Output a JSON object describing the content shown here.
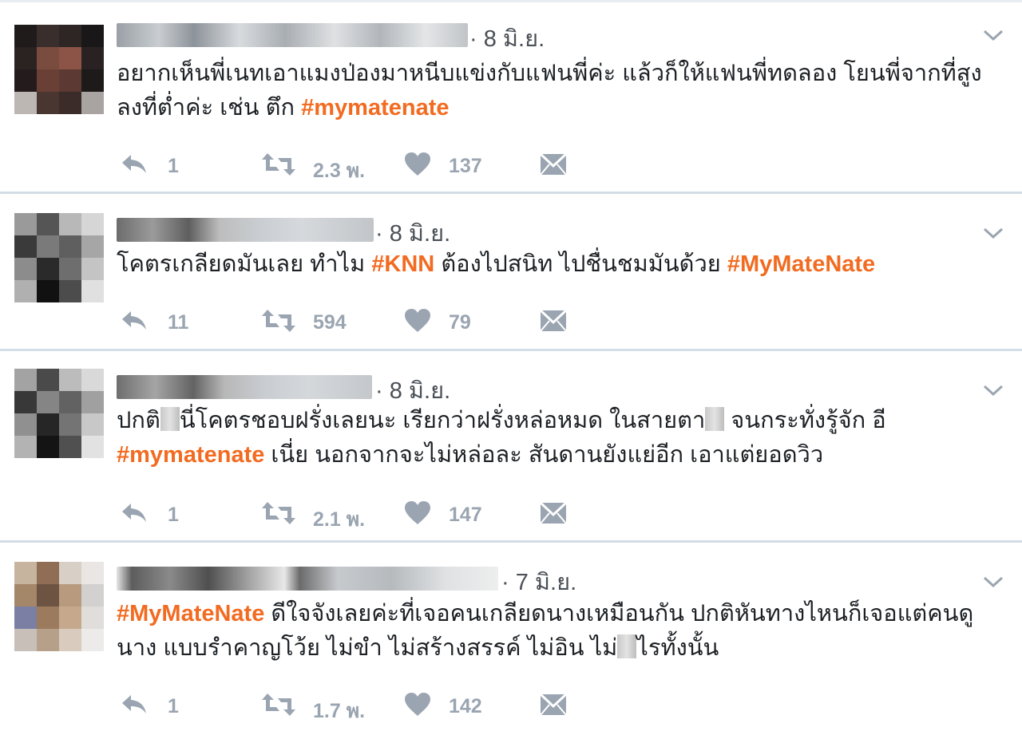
{
  "colors": {
    "hashtag": "#f26b21",
    "icon": "#9aa5b1",
    "separator": "#d3dde5"
  },
  "icons": {
    "reply": "reply-arrow-icon",
    "retweet": "retweet-icon",
    "like": "heart-icon",
    "dm": "envelope-icon",
    "menu": "chevron-down-icon"
  },
  "tweets": [
    {
      "date": "· 8 มิ.ย.",
      "lines": [
        [
          {
            "t": "อยากเห็นพี่เนทเอาแมงป่องมาหนีบแข่งกับแฟนพี่ค่ะ แล้วก็ให้แฟนพี่ทดลอง โยนพี่จากที่สูง"
          }
        ],
        [
          {
            "t": "ลงที่ต่ำค่ะ เช่น ตึก "
          },
          {
            "t": "#mymatenate",
            "tag": true
          }
        ]
      ],
      "replies": "1",
      "retweets": "2.3 พ.",
      "likes": "137"
    },
    {
      "date": "· 8 มิ.ย.",
      "lines": [
        [
          {
            "t": "โคตรเกลียดมันเลย ทำไม "
          },
          {
            "t": "#KNN",
            "tag": true
          },
          {
            "t": " ต้องไปสนิท ไปชื่นชมมันด้วย "
          },
          {
            "t": "#MyMateNate",
            "tag": true
          }
        ]
      ],
      "replies": "11",
      "retweets": "594",
      "likes": "79"
    },
    {
      "date": "· 8 มิ.ย.",
      "lines": [
        [
          {
            "t": "ปกติ"
          },
          {
            "redact": true
          },
          {
            "t": "นี่โคตรชอบฝรั่งเลยนะ เรียกว่าฝรั่งหล่อหมด ในสายตา"
          },
          {
            "redact": true
          },
          {
            "t": " จนกระทั่งรู้จัก อี"
          }
        ],
        [
          {
            "t": "#mymatenate",
            "tag": true
          },
          {
            "t": " เนี่ย นอกจากจะไม่หล่อละ สันดานยังแย่อีก เอาแต่ยอดวิว"
          }
        ]
      ],
      "replies": "1",
      "retweets": "2.1 พ.",
      "likes": "147"
    },
    {
      "date": "· 7 มิ.ย.",
      "lines": [
        [
          {
            "t": "#MyMateNate",
            "tag": true
          },
          {
            "t": " ดีใจจังเลยค่ะที่เจอคนเกลียดนางเหมือนกัน ปกติหันทางไหนก็เจอแต่คนดู"
          }
        ],
        [
          {
            "t": "นาง แบบรำคาญโว้ย ไม่ขำ ไม่สร้างสรรค์ ไม่อิน ไม่"
          },
          {
            "redact": true
          },
          {
            "t": "ไรทั้งนั้น"
          }
        ]
      ],
      "replies": "1",
      "retweets": "1.7 พ.",
      "likes": "142"
    }
  ]
}
